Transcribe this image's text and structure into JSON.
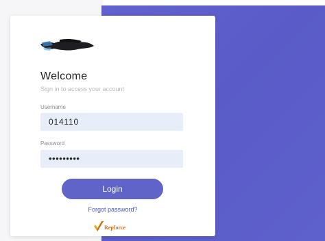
{
  "login": {
    "title": "Welcome",
    "subtitle": "Sign in to access your account",
    "username_label": "Username",
    "username_value": "014110",
    "password_label": "Password",
    "password_value": "•••••••••",
    "login_button": "Login",
    "forgot_link": "Forgot password?"
  },
  "brand": {
    "name": "Repforce"
  },
  "colors": {
    "background_accent": "#5e60cc",
    "input_bg": "#e8eef9",
    "button_bg": "#6063c8",
    "link": "#4b59b9",
    "brand_orange": "#d8741e"
  }
}
